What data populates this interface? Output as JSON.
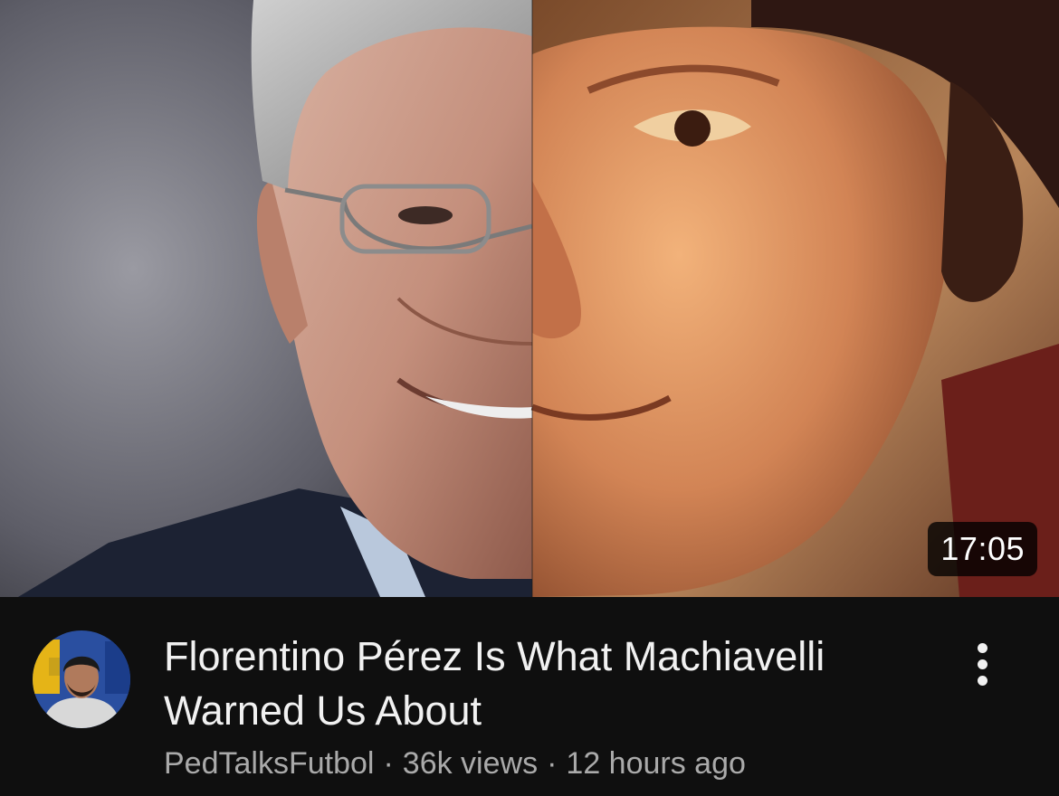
{
  "video": {
    "title": "Florentino Pérez Is What Machiavelli Warned Us About",
    "duration": "17:05",
    "channel": "PedTalksFutbol",
    "separator": "·",
    "views": "36k views",
    "age": "12 hours ago"
  },
  "icons": {
    "more": "vertical-dots-icon",
    "avatar": "channel-avatar"
  },
  "colors": {
    "background": "#0f0f0f",
    "title": "#f1f1f1",
    "secondary_text": "#aaaaaa"
  }
}
